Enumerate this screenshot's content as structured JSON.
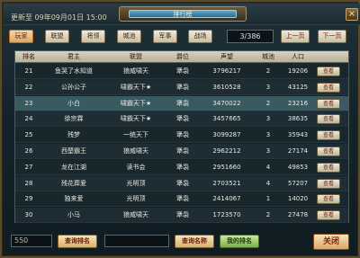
{
  "header": {
    "update_time": "更新至 09年09月01日 15:00",
    "title": "排行榜",
    "close_glyph": "×"
  },
  "tabs": [
    {
      "label": "玩家",
      "active": true
    },
    {
      "label": "联盟",
      "active": false
    },
    {
      "label": "将领",
      "active": false
    },
    {
      "label": "城池",
      "active": false
    },
    {
      "label": "军事",
      "active": false
    },
    {
      "label": "战场",
      "active": false
    }
  ],
  "pagination": {
    "page_text": "3/386",
    "prev_label": "上一页",
    "next_label": "下一页"
  },
  "table": {
    "columns": [
      "排名",
      "君主",
      "联盟",
      "爵位",
      "声望",
      "城池",
      "人口",
      ""
    ],
    "view_label": "查看",
    "rows": [
      {
        "rank": "21",
        "lord": "鱼哭了水知道",
        "alliance": "狼威啸天",
        "title": "犟袅",
        "prestige": "3796217",
        "cities": "2",
        "population": "19206"
      },
      {
        "rank": "22",
        "lord": "公孙公子",
        "alliance": "啸霸天下★",
        "title": "犟袅",
        "prestige": "3610528",
        "cities": "3",
        "population": "43125"
      },
      {
        "rank": "23",
        "lord": "小白",
        "alliance": "啸霸天下★",
        "title": "犟袅",
        "prestige": "3470022",
        "cities": "2",
        "population": "23216"
      },
      {
        "rank": "24",
        "lord": "徐宗霖",
        "alliance": "啸霸天下★",
        "title": "犟袅",
        "prestige": "3457665",
        "cities": "3",
        "population": "38635"
      },
      {
        "rank": "25",
        "lord": "残梦",
        "alliance": "一统天下",
        "title": "犟袅",
        "prestige": "3099287",
        "cities": "3",
        "population": "35943"
      },
      {
        "rank": "26",
        "lord": "西楚霸王",
        "alliance": "狼威啸天",
        "title": "犟袅",
        "prestige": "2962212",
        "cities": "3",
        "population": "27174"
      },
      {
        "rank": "27",
        "lord": "龙在江湖",
        "alliance": "读书会",
        "title": "犟袅",
        "prestige": "2951660",
        "cities": "4",
        "population": "49853"
      },
      {
        "rank": "28",
        "lord": "残花葬爱",
        "alliance": "光明顶",
        "title": "犟袅",
        "prestige": "2703521",
        "cities": "4",
        "population": "57207"
      },
      {
        "rank": "29",
        "lord": "独来爱",
        "alliance": "光明顶",
        "title": "犟袅",
        "prestige": "2414067",
        "cities": "1",
        "population": "14020"
      },
      {
        "rank": "30",
        "lord": "小马",
        "alliance": "狼威啸天",
        "title": "犟袅",
        "prestige": "1723570",
        "cities": "2",
        "population": "27478"
      }
    ],
    "selected_index": 2
  },
  "footer": {
    "rank_input_value": "550",
    "rank_query_label": "查询排名",
    "name_input_value": "",
    "name_query_label": "查询名称",
    "my_rank_label": "我的排名",
    "close_label": "关闭"
  }
}
